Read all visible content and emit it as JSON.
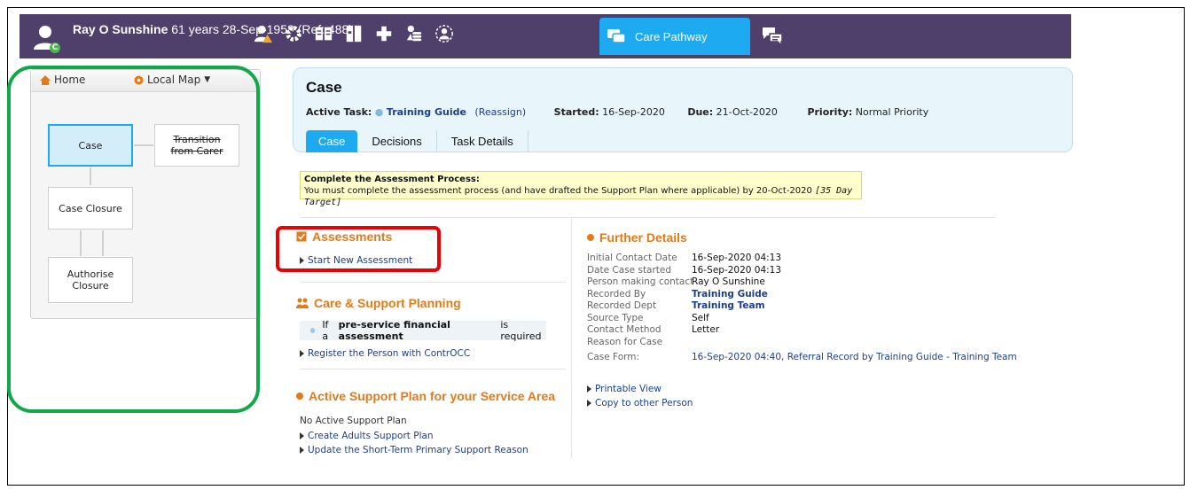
{
  "header": {
    "person_name": "Ray O Sunshine",
    "person_details": " 61 years 28-Sep-1958 (Ref: 488)",
    "badge": "C",
    "care_tab_label": "Care Pathway",
    "icons": [
      "person-warning-icon",
      "gear-icon",
      "book-icon",
      "folder-icon",
      "plus-icon",
      "coins-icon",
      "money-face-icon"
    ]
  },
  "map": {
    "home_label": "Home",
    "local_map_label": "Local Map",
    "nodes": {
      "case": "Case",
      "transition": "Transition from Carer",
      "closure": "Case Closure",
      "authorise": "Authorise Closure"
    }
  },
  "case": {
    "title": "Case",
    "active_task_label": "Active Task:",
    "active_task_value": "Training Guide",
    "reassign": "(Reassign)",
    "started_label": "Started:",
    "started_value": "16-Sep-2020",
    "due_label": "Due:",
    "due_value": "21-Oct-2020",
    "priority_label": "Priority:",
    "priority_value": "Normal Priority",
    "tabs": [
      "Case",
      "Decisions",
      "Task Details"
    ]
  },
  "notice": {
    "title": "Complete the Assessment Process:",
    "body": "You must complete the assessment process (and have drafted the Support Plan where applicable) by 20-Oct-2020 ",
    "target": "[35 Day Target]"
  },
  "assessments": {
    "title": "Assessments",
    "link": "Start New Assessment"
  },
  "care_support": {
    "title": "Care & Support Planning",
    "info_pre": "If a ",
    "info_bold": "pre-service financial assessment",
    "info_post": " is required",
    "link": "Register the Person with ContrOCC"
  },
  "active_plan": {
    "title": "Active Support Plan for your Service Area",
    "none": "No Active Support Plan",
    "link1": "Create Adults Support Plan",
    "link2": "Update the Short-Term Primary Support Reason"
  },
  "further": {
    "title": "Further Details",
    "rows": [
      {
        "label": "Initial Contact Date",
        "value": "16-Sep-2020 04:13"
      },
      {
        "label": "Date Case started",
        "value": "16-Sep-2020 04:13"
      },
      {
        "label": "Person making contact",
        "value": "Ray O Sunshine"
      },
      {
        "label": "Recorded By",
        "value": "Training Guide"
      },
      {
        "label": "Recorded Dept",
        "value": "Training Team"
      },
      {
        "label": "Source Type",
        "value": "Self"
      },
      {
        "label": "Contact Method",
        "value": "Letter"
      },
      {
        "label": "Reason for Case",
        "value": ""
      },
      {
        "label": "Case Form:",
        "value": "16-Sep-2020 04:40, Referral Record by Training Guide - Training Team"
      }
    ],
    "link1": "Printable View",
    "link2": "Copy to other Person"
  }
}
